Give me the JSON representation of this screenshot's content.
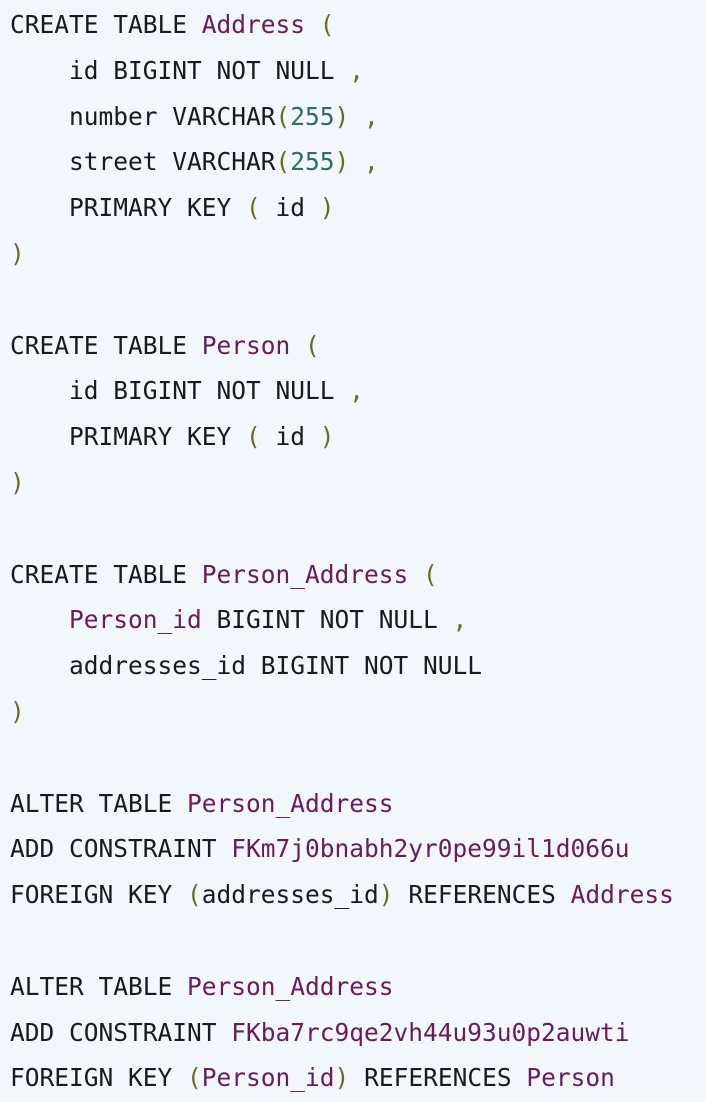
{
  "colors": {
    "background": "#f1f7fd",
    "keyword": "#1a1a1a",
    "name": "#6a1b5b",
    "punctuation": "#6b6b1f",
    "number": "#2f6b6b"
  },
  "code": {
    "lines": [
      [
        {
          "t": "CREATE TABLE ",
          "c": "kw"
        },
        {
          "t": "Address",
          "c": "name"
        },
        {
          "t": " (",
          "c": "punc"
        }
      ],
      [
        {
          "t": "    id BIGINT NOT NULL",
          "c": "kw"
        },
        {
          "t": " ,",
          "c": "punc"
        }
      ],
      [
        {
          "t": "    number VARCHAR",
          "c": "kw"
        },
        {
          "t": "(",
          "c": "punc"
        },
        {
          "t": "255",
          "c": "num"
        },
        {
          "t": ") ,",
          "c": "punc"
        }
      ],
      [
        {
          "t": "    street VARCHAR",
          "c": "kw"
        },
        {
          "t": "(",
          "c": "punc"
        },
        {
          "t": "255",
          "c": "num"
        },
        {
          "t": ") ,",
          "c": "punc"
        }
      ],
      [
        {
          "t": "    PRIMARY KEY ",
          "c": "kw"
        },
        {
          "t": "( ",
          "c": "punc"
        },
        {
          "t": "id",
          "c": "kw"
        },
        {
          "t": " )",
          "c": "punc"
        }
      ],
      [
        {
          "t": ")",
          "c": "punc"
        }
      ],
      [],
      [
        {
          "t": "CREATE TABLE ",
          "c": "kw"
        },
        {
          "t": "Person",
          "c": "name"
        },
        {
          "t": " (",
          "c": "punc"
        }
      ],
      [
        {
          "t": "    id BIGINT NOT NULL",
          "c": "kw"
        },
        {
          "t": " ,",
          "c": "punc"
        }
      ],
      [
        {
          "t": "    PRIMARY KEY ",
          "c": "kw"
        },
        {
          "t": "( ",
          "c": "punc"
        },
        {
          "t": "id",
          "c": "kw"
        },
        {
          "t": " )",
          "c": "punc"
        }
      ],
      [
        {
          "t": ")",
          "c": "punc"
        }
      ],
      [],
      [
        {
          "t": "CREATE TABLE ",
          "c": "kw"
        },
        {
          "t": "Person_Address",
          "c": "name"
        },
        {
          "t": " (",
          "c": "punc"
        }
      ],
      [
        {
          "t": "    ",
          "c": "kw"
        },
        {
          "t": "Person_id",
          "c": "name"
        },
        {
          "t": " BIGINT NOT NULL",
          "c": "kw"
        },
        {
          "t": " ,",
          "c": "punc"
        }
      ],
      [
        {
          "t": "    addresses_id BIGINT NOT NULL",
          "c": "kw"
        }
      ],
      [
        {
          "t": ")",
          "c": "punc"
        }
      ],
      [],
      [
        {
          "t": "ALTER TABLE ",
          "c": "kw"
        },
        {
          "t": "Person_Address",
          "c": "name"
        }
      ],
      [
        {
          "t": "ADD CONSTRAINT ",
          "c": "kw"
        },
        {
          "t": "FKm7j0bnabh2yr0pe99il1d066u",
          "c": "name"
        }
      ],
      [
        {
          "t": "FOREIGN KEY ",
          "c": "kw"
        },
        {
          "t": "(",
          "c": "punc"
        },
        {
          "t": "addresses_id",
          "c": "kw"
        },
        {
          "t": ")",
          "c": "punc"
        },
        {
          "t": " REFERENCES ",
          "c": "kw"
        },
        {
          "t": "Address",
          "c": "name"
        }
      ],
      [],
      [
        {
          "t": "ALTER TABLE ",
          "c": "kw"
        },
        {
          "t": "Person_Address",
          "c": "name"
        }
      ],
      [
        {
          "t": "ADD CONSTRAINT ",
          "c": "kw"
        },
        {
          "t": "FKba7rc9qe2vh44u93u0p2auwti",
          "c": "name"
        }
      ],
      [
        {
          "t": "FOREIGN KEY ",
          "c": "kw"
        },
        {
          "t": "(",
          "c": "punc"
        },
        {
          "t": "Person_id",
          "c": "name"
        },
        {
          "t": ")",
          "c": "punc"
        },
        {
          "t": " REFERENCES ",
          "c": "kw"
        },
        {
          "t": "Person",
          "c": "name"
        }
      ]
    ]
  }
}
